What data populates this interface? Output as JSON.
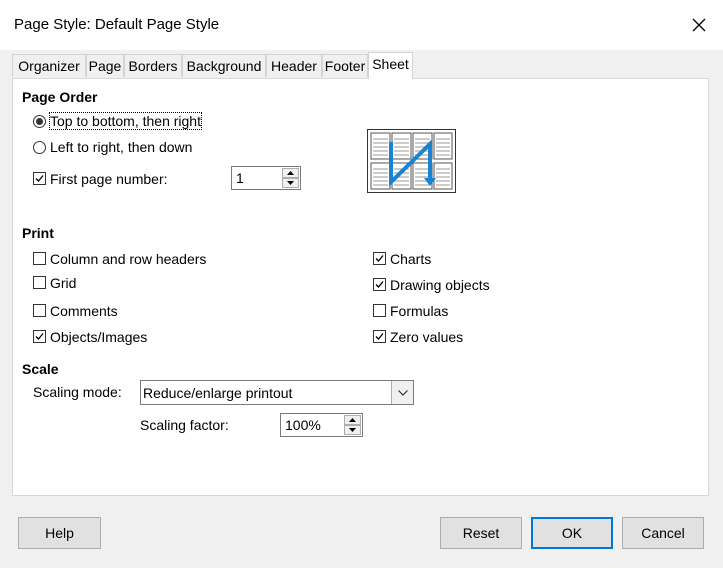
{
  "window": {
    "title": "Page Style: Default Page Style"
  },
  "tabs": [
    {
      "label": "Organizer"
    },
    {
      "label": "Page"
    },
    {
      "label": "Borders"
    },
    {
      "label": "Background"
    },
    {
      "label": "Header"
    },
    {
      "label": "Footer"
    },
    {
      "label": "Sheet",
      "active": true
    }
  ],
  "page_order": {
    "heading": "Page Order",
    "top_to_bottom": {
      "label": "Top to bottom, then right",
      "selected": true
    },
    "left_to_right": {
      "label": "Left to right, then down",
      "selected": false
    },
    "first_page_number": {
      "label": "First page number:",
      "checked": true,
      "value": "1"
    }
  },
  "print": {
    "heading": "Print",
    "items": [
      {
        "label": "Column and row headers",
        "checked": false
      },
      {
        "label": "Grid",
        "checked": false
      },
      {
        "label": "Comments",
        "checked": false
      },
      {
        "label": "Objects/Images",
        "checked": true
      },
      {
        "label": "Charts",
        "checked": true
      },
      {
        "label": "Drawing objects",
        "checked": true
      },
      {
        "label": "Formulas",
        "checked": false
      },
      {
        "label": "Zero values",
        "checked": true
      }
    ]
  },
  "scale": {
    "heading": "Scale",
    "mode_label": "Scaling mode:",
    "mode_value": "Reduce/enlarge printout",
    "factor_label": "Scaling factor:",
    "factor_value": "100%"
  },
  "buttons": {
    "help": "Help",
    "reset": "Reset",
    "ok": "OK",
    "cancel": "Cancel"
  },
  "colors": {
    "accent": "#0078d7",
    "arrow": "#1a82d0"
  }
}
